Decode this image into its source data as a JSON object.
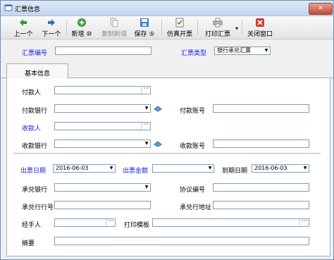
{
  "window": {
    "title": "汇票信息",
    "close_glyph": "✕"
  },
  "toolbar": {
    "prev": "上一个",
    "next": "下一个",
    "add": "新增 ⑩",
    "copy_add": "复制新增",
    "save": "保存 ⑤",
    "simulate": "仿真开票",
    "print": "打印汇票",
    "close": "关闭窗口"
  },
  "header": {
    "draft_no_label": "汇票编号",
    "draft_no_value": "",
    "draft_type_label": "汇票类型",
    "draft_type_value": "银行承兑汇票"
  },
  "tabs": {
    "basic": "基本信息"
  },
  "form": {
    "payer_label": "付款人",
    "payer_value": "",
    "payer_bank_label": "付款银行",
    "payer_bank_value": "",
    "payer_account_label": "付款账号",
    "payer_account_value": "",
    "payee_label": "收款人",
    "payee_value": "",
    "payee_bank_label": "收款银行",
    "payee_bank_value": "",
    "payee_account_label": "收款账号",
    "payee_account_value": "",
    "issue_date_label": "出票日期",
    "issue_date_value": "2016-06-03",
    "amount_label": "出票金额",
    "amount_value": "",
    "due_date_label": "到期日期",
    "due_date_value": "2016-06-03",
    "accept_bank_label": "承兑银行",
    "accept_bank_value": "",
    "agreement_label": "协议编号",
    "agreement_value": "",
    "accept_bank_no_label": "承兑行行号",
    "accept_bank_no_value": "",
    "accept_bank_addr_label": "承兑行地址",
    "accept_bank_addr_value": "",
    "handler_label": "经手人",
    "handler_value": "",
    "template_label": "打印模板",
    "template_value": "",
    "memo_label": "摘要",
    "memo_value": ""
  },
  "glyphs": {
    "dropdown": "▼",
    "ellipsis": "···"
  }
}
